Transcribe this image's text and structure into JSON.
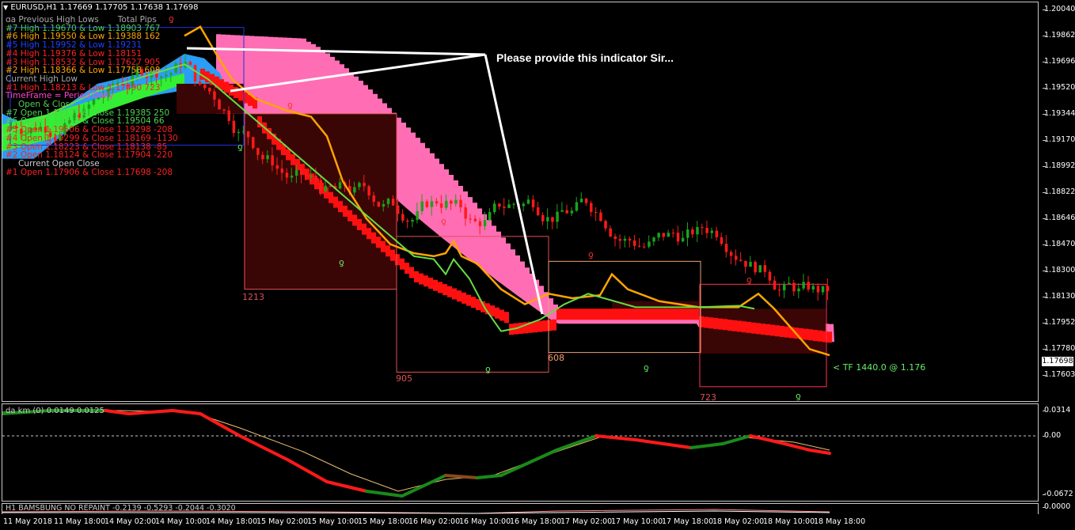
{
  "window": {
    "symbol_line": "EURUSD,H1  1.17669 1.17705 1.17638 1.17698"
  },
  "colors": {
    "bull": "#1aa31a",
    "bear": "#ff1a1a",
    "pink": "#ff6eb4",
    "blue_band": "#2a9df4",
    "orange_line": "#ffa500",
    "green_line": "#66dd44",
    "box_red": "#e05050",
    "box_orange": "#f0a070",
    "dark_fill": "#3a0505"
  },
  "info_panel": {
    "header_left": "ɑa Previous High Lows",
    "header_right": "Total Pips",
    "highs": [
      {
        "label": "#7 High 1.19670  &  Low 1.18903   767",
        "color": "#4fd24f"
      },
      {
        "label": "#6 High 1.19550  &  Low 1.19388   162",
        "color": "#ffa500"
      },
      {
        "label": "#5 High 1.19952  &  Low 1.19231   ",
        "color": "#2040ff"
      },
      {
        "label": "#4 High 1.19376  &  Low 1.18151   ",
        "color": "#ff2020"
      },
      {
        "label": "#3 High 1.18532  &  Low 1.17627   905",
        "color": "#ff2020"
      },
      {
        "label": "#2 High 1.18366  &  Low 1.17758   608",
        "color": "#ffa500"
      },
      {
        "label": "    Current High Low",
        "color": "#aaaaaa"
      },
      {
        "label": "#1 High 1.18213  &  Low 1.17490   723",
        "color": "#ff2020"
      }
    ],
    "timeframe": "TimeFrame = Period Daily",
    "open_header": "Open & Close",
    "opens": [
      {
        "label": "#7 Open 1.19135  &  Close 1.19385   250",
        "color": "#4fd24f"
      },
      {
        "label": "#6 Open 1.19438  &  Close 1.19504   66",
        "color": "#4fd24f"
      },
      {
        "label": "#5 Open 1.19506  &  Close 1.19298   -208",
        "color": "#ff2020"
      },
      {
        "label": "#4 Open 1.19299  &  Close 1.18169   -1130",
        "color": "#ff2020"
      },
      {
        "label": "#3 Open 1.18223  &  Close 1.18138   -85",
        "color": "#ff2020"
      },
      {
        "label": "#2 Open 1.18124  &  Close 1.17904   -220",
        "color": "#ff2020"
      }
    ],
    "current_open_header": "Current Open Close",
    "current_open": {
      "label": "#1 Open 1.17906  &  Close 1.17698   -208",
      "color": "#ff2020"
    }
  },
  "callout": {
    "text": "Please provide this indicator Sir..."
  },
  "boxes": [
    {
      "label": "1213",
      "color": "#e05050"
    },
    {
      "label": "905",
      "color": "#e05050"
    },
    {
      "label": "608",
      "color": "#f0a070"
    },
    {
      "label": "723",
      "color": "#e05050"
    }
  ],
  "tf_label": "< TF 1440.0  @  1.176",
  "price_axis": {
    "ticks": [
      "1.20040",
      "1.19862",
      "1.19696",
      "1.19520",
      "1.19344",
      "1.19170",
      "1.18992",
      "1.18822",
      "1.18646",
      "1.18470",
      "1.18300",
      "1.18130",
      "1.17952",
      "1.17780",
      "1.17603"
    ],
    "current_price": "1.17698"
  },
  "osc_panel": {
    "label": "da km (0)  0.0149  0.0125",
    "ticks": [
      "0.0314",
      "0.00",
      "-0.0672"
    ]
  },
  "sub_panel": {
    "label": "H1  BAMSBUNG NO REPAINT  -0.2139 -0.5293 -0.2044 -0.3020",
    "ticks": [
      "0.0000"
    ]
  },
  "time_axis": {
    "ticks": [
      "11 May 2018",
      "11 May 18:00",
      "14 May 02:00",
      "14 May 10:00",
      "14 May 18:00",
      "15 May 02:00",
      "15 May 10:00",
      "15 May 18:00",
      "16 May 02:00",
      "16 May 10:00",
      "16 May 18:00",
      "17 May 02:00",
      "17 May 10:00",
      "17 May 18:00",
      "18 May 02:00",
      "18 May 10:00",
      "18 May 18:00"
    ]
  },
  "marker_glyph": "ƍ"
}
